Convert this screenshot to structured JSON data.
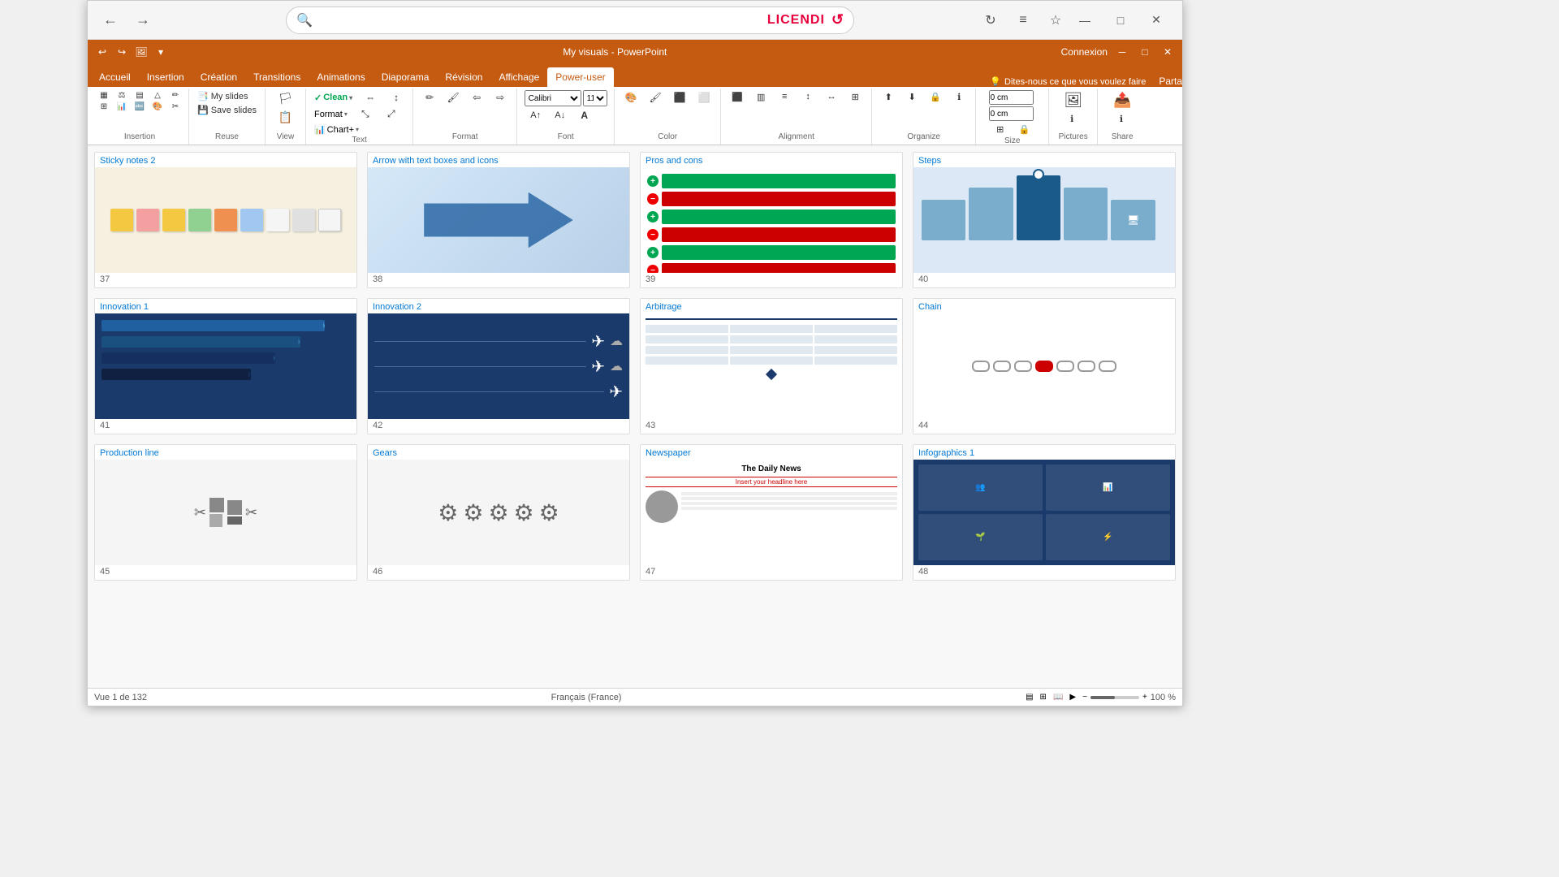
{
  "browser": {
    "title": "My visuals - PowerPoint",
    "back_label": "←",
    "forward_label": "→",
    "reload_label": "↻",
    "menu_label": "≡",
    "star_label": "☆",
    "address": "",
    "search_icon": "🔍",
    "logo": "LICENDI",
    "minimize_label": "—",
    "maximize_label": "□",
    "close_label": "✕"
  },
  "powerpoint": {
    "title": "My visuals - PowerPoint",
    "connexion": "Connexion",
    "partage": "Parta",
    "qat": [
      "↩",
      "↪",
      "🖼",
      "▾"
    ],
    "tabs": [
      "Accueil",
      "Insertion",
      "Création",
      "Transitions",
      "Animations",
      "Diaporama",
      "Révision",
      "Affichage",
      "Power-user"
    ],
    "active_tab": "Power-user",
    "search_placeholder": "Dites-nous ce que vous voulez faire",
    "ribbon_groups": {
      "insertion": "Insertion",
      "reuse": "Reuse",
      "view": "View",
      "text": "Text",
      "format": "Format",
      "font": "Font",
      "color": "Color",
      "alignment": "Alignment",
      "organize": "Organize",
      "size": "Size",
      "pictures": "Pictures",
      "share": "Share"
    },
    "ribbon_buttons": {
      "my_slides": "My slides",
      "save_slides": "Save slides",
      "clean": "✓ Clean",
      "format": "Format",
      "chart_plus": "Chart+",
      "clean_dropdown": "▾",
      "format_dropdown": "▾"
    }
  },
  "gallery": {
    "rows": [
      [
        {
          "num": "37",
          "title": "Sticky notes 2",
          "type": "sticky"
        },
        {
          "num": "38",
          "title": "Arrow with text boxes and icons",
          "type": "arrow"
        },
        {
          "num": "39",
          "title": "Pros and cons",
          "type": "proscons"
        },
        {
          "num": "40",
          "title": "Steps",
          "type": "steps"
        }
      ],
      [
        {
          "num": "41",
          "title": "Innovation 1",
          "type": "innov1"
        },
        {
          "num": "42",
          "title": "Innovation 2",
          "type": "innov2"
        },
        {
          "num": "43",
          "title": "Arbitrage",
          "type": "arbitrage"
        },
        {
          "num": "44",
          "title": "Chain",
          "type": "chain"
        }
      ],
      [
        {
          "num": "45",
          "title": "Production line",
          "type": "prodline"
        },
        {
          "num": "46",
          "title": "Gears",
          "type": "gears"
        },
        {
          "num": "47",
          "title": "Newspaper",
          "type": "newspaper"
        },
        {
          "num": "48",
          "title": "Infographics 1",
          "type": "infographics"
        }
      ]
    ]
  },
  "statusbar": {
    "slide_info": "Vue 1 de 132",
    "language": "Français (France)",
    "zoom": "100 %"
  }
}
